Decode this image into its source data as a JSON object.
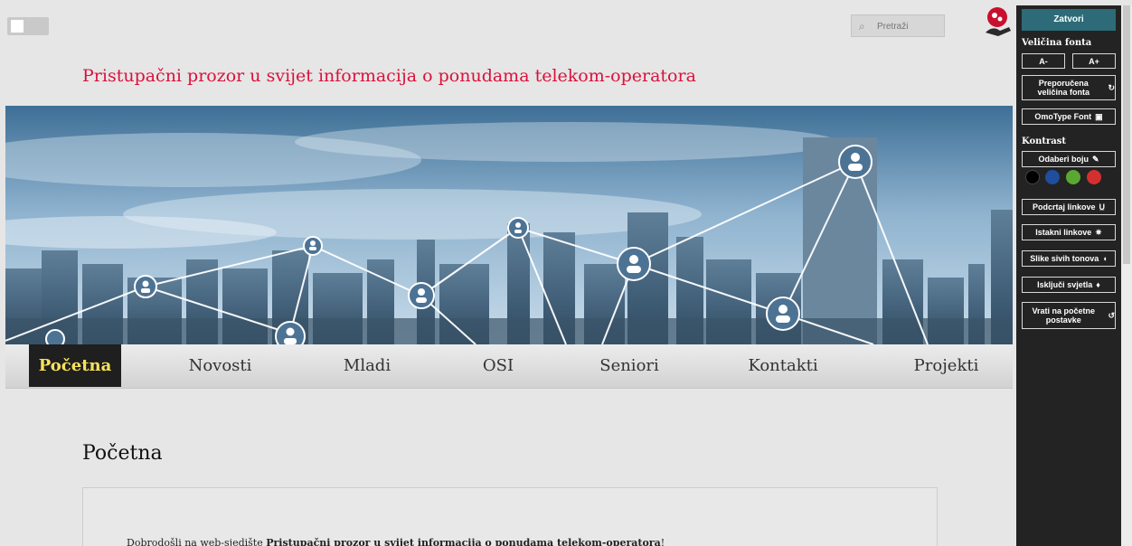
{
  "header": {
    "search_placeholder": "Pretraži",
    "search_icon": "search-icon",
    "site_title": "Pristupačni prozor u svijet informacija o ponudama telekom-operatora"
  },
  "nav": {
    "items": [
      {
        "label": "Početna",
        "active": true
      },
      {
        "label": "Novosti",
        "active": false
      },
      {
        "label": "Mladi",
        "active": false
      },
      {
        "label": "OSI",
        "active": false
      },
      {
        "label": "Seniori",
        "active": false
      },
      {
        "label": "Kontakti",
        "active": false
      },
      {
        "label": "Projekti",
        "active": false
      }
    ]
  },
  "main": {
    "heading": "Početna",
    "welcome_prefix": "Dobrodošli na web-sjedište ",
    "welcome_bold": "Pristupačni prozor u svijet informacija o ponudama telekom-operatora",
    "welcome_suffix": "!"
  },
  "accessibility_panel": {
    "close": "Zatvori",
    "font_size_label": "Veličina fonta",
    "decrease": "A-",
    "increase": "A+",
    "recommended_size": "Preporučena veličina fonta",
    "omotype": "OmoType Font",
    "contrast_label": "Kontrast",
    "choose_color": "Odaberi boju",
    "swatches": [
      "#000000",
      "#1f4e9e",
      "#5aa832",
      "#d32f2f"
    ],
    "underline_links": "Podcrtaj linkove",
    "highlight_links": "Istakni linkove",
    "grayscale_images": "Slike sivih tonova",
    "lights_off": "Isključi svjetla",
    "reset": "Vrati na početne postavke"
  },
  "colors": {
    "title_red": "#d9123b",
    "nav_active_bg": "#1f1f1f",
    "nav_active_text": "#f7e25a",
    "panel_bg": "#232323",
    "panel_close_bg": "#2d6b78"
  }
}
